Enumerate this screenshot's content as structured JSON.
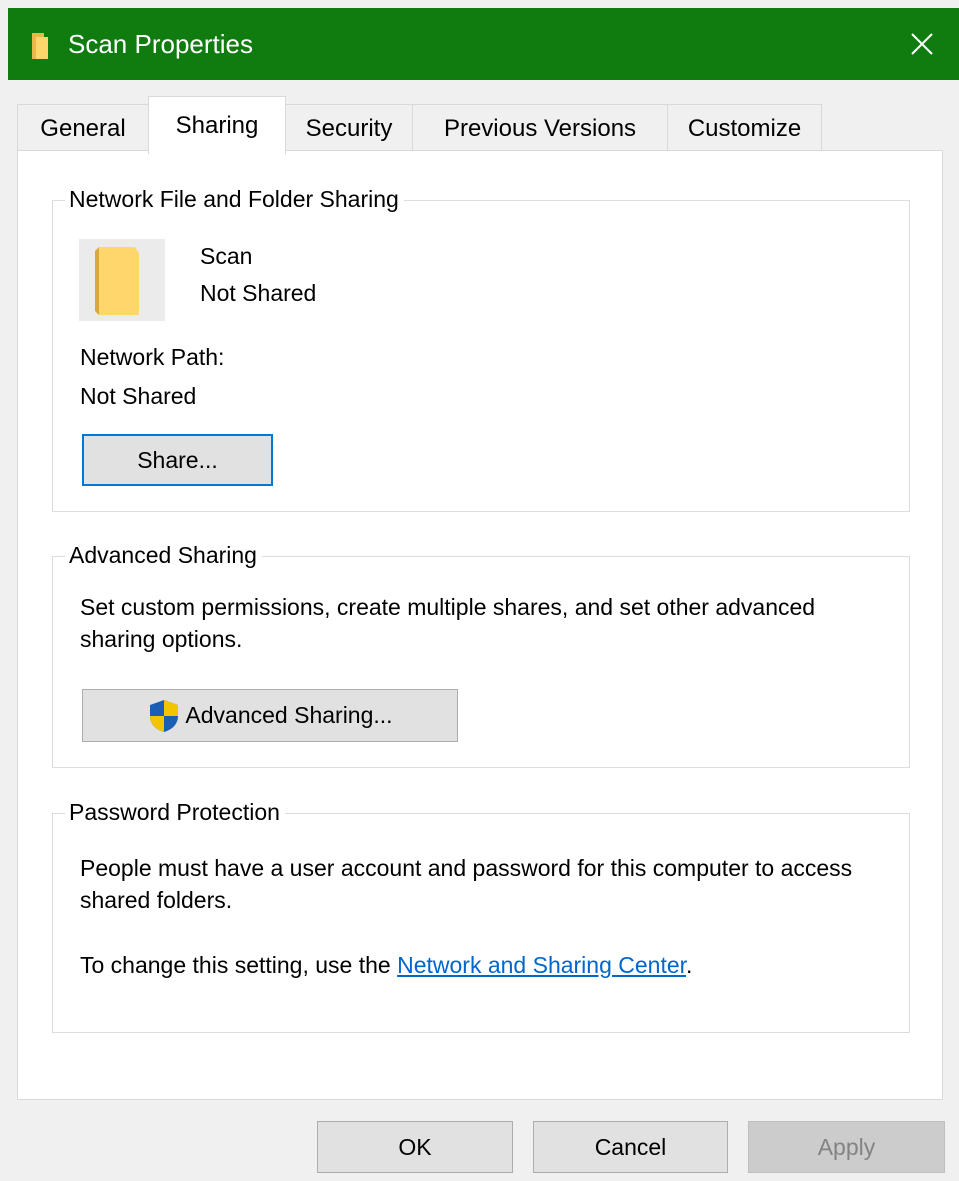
{
  "window": {
    "title": "Scan Properties"
  },
  "tabs": [
    {
      "label": "General"
    },
    {
      "label": "Sharing"
    },
    {
      "label": "Security"
    },
    {
      "label": "Previous Versions"
    },
    {
      "label": "Customize"
    }
  ],
  "network_sharing": {
    "group_title": "Network File and Folder Sharing",
    "folder_name": "Scan",
    "folder_status": "Not Shared",
    "path_label": "Network Path:",
    "path_value": "Not Shared",
    "share_button": "Share..."
  },
  "advanced_sharing": {
    "group_title": "Advanced Sharing",
    "description": "Set custom permissions, create multiple shares, and set other advanced sharing options.",
    "button": "Advanced Sharing..."
  },
  "password_protection": {
    "group_title": "Password Protection",
    "description": "People must have a user account and password for this computer to access shared folders.",
    "change_prefix": "To change this setting, use the ",
    "link_text": "Network and Sharing Center",
    "change_suffix": "."
  },
  "footer": {
    "ok": "OK",
    "cancel": "Cancel",
    "apply": "Apply"
  },
  "colors": {
    "titlebar": "#107c10",
    "accent": "#0078d7",
    "link": "#0066cc"
  }
}
